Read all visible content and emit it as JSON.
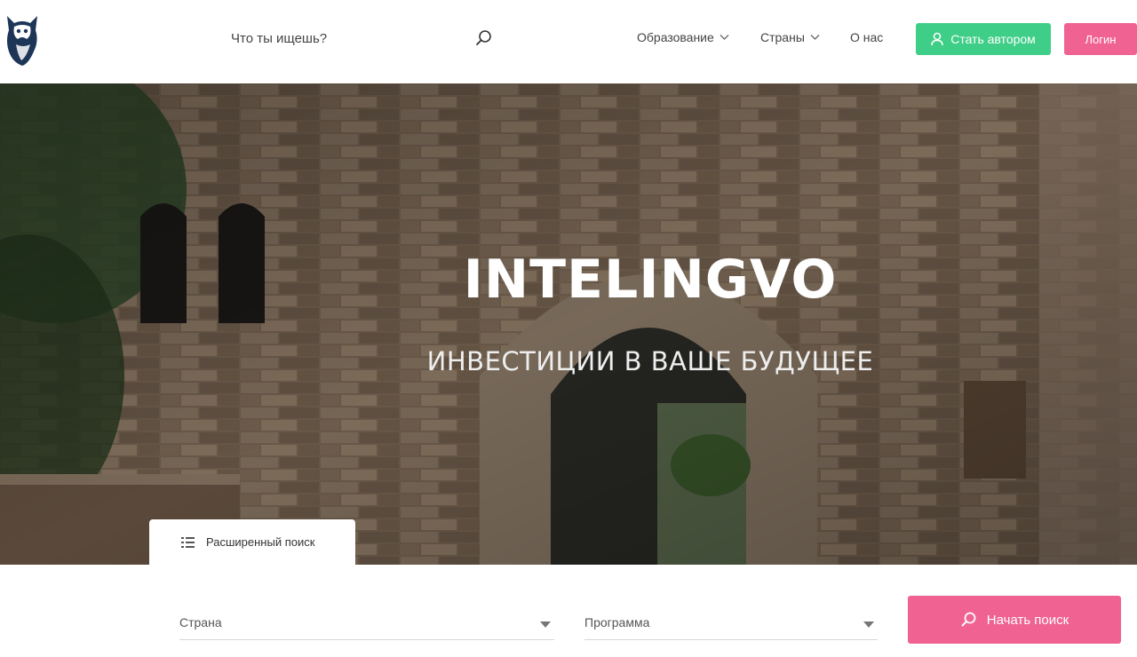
{
  "header": {
    "logo_icon": "owl-logo-icon",
    "search": {
      "placeholder": "Что ты ищешь?",
      "icon": "search-icon"
    },
    "nav": [
      {
        "label": "Образование",
        "dropdown": true
      },
      {
        "label": "Страны",
        "dropdown": true
      },
      {
        "label": "О нас",
        "dropdown": false
      }
    ],
    "become_author": {
      "label": "Стать автором",
      "icon": "user-icon",
      "color": "#3fce87"
    },
    "login": {
      "label": "Логин",
      "color": "#f06292"
    }
  },
  "hero": {
    "title": "INTELINGVO",
    "subtitle": "ИНВЕСТИЦИИ В ВАШЕ БУДУЩЕЕ",
    "advanced_search_tab": {
      "label": "Расширенный поиск",
      "icon": "list-icon"
    }
  },
  "search_form": {
    "country": {
      "label": "Страна"
    },
    "program": {
      "label": "Программа"
    },
    "submit": {
      "label": "Начать поиск",
      "icon": "search-icon",
      "color": "#f06292"
    }
  }
}
